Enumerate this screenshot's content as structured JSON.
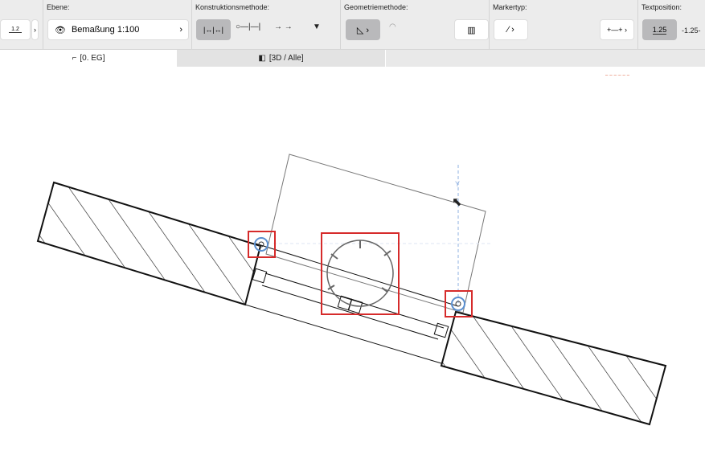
{
  "toolbar": {
    "preset_icon_label": "1.2",
    "ebene": {
      "label": "Ebene:",
      "value": "Bemaßung 1:100"
    },
    "konstruktion": {
      "label": "Konstruktionsmethode:"
    },
    "geometrie": {
      "label": "Geometriemethode:"
    },
    "marker": {
      "label": "Markertyp:"
    },
    "text": {
      "label": "Textposition:",
      "opt1": "1.25",
      "opt2": "-1.25-"
    }
  },
  "tabs": [
    {
      "label": "[0. EG]"
    },
    {
      "label": "[3D / Alle]"
    }
  ],
  "canvas": {
    "axis_label": "Y"
  },
  "colors": {
    "highlight": "#d62b2b",
    "guide": "#8fb0e0"
  }
}
